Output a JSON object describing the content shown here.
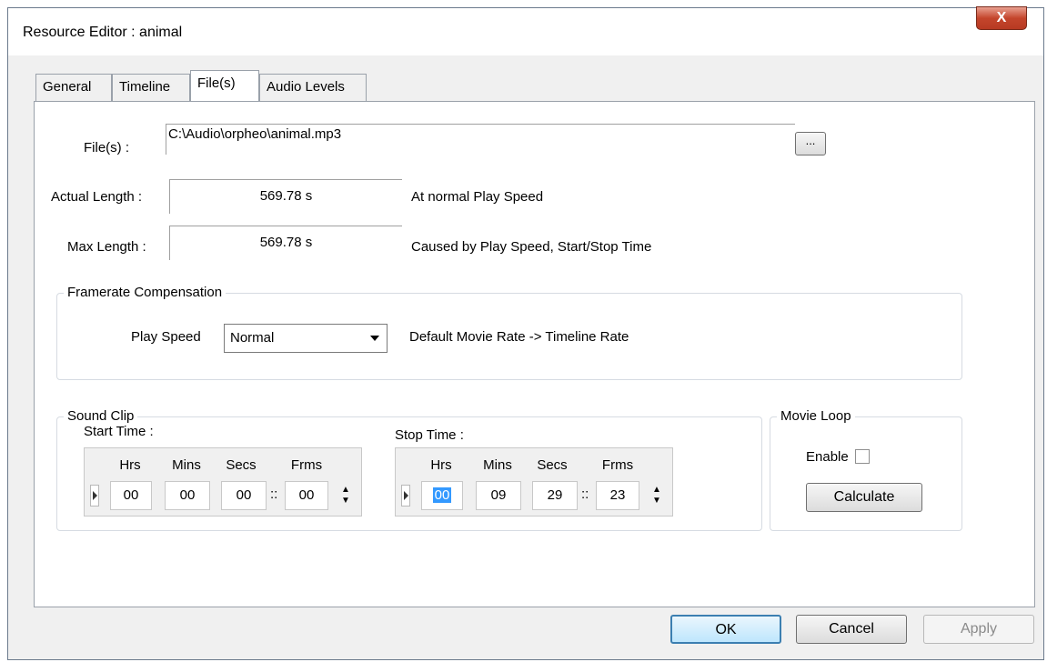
{
  "window": {
    "title": "Resource Editor  :  animal",
    "close_glyph": "X"
  },
  "tabs": [
    {
      "label": "General"
    },
    {
      "label": "Timeline"
    },
    {
      "label": "File(s)"
    },
    {
      "label": "Audio Levels"
    }
  ],
  "files": {
    "label": "File(s) :",
    "path": "C:\\Audio\\orpheo\\animal.mp3",
    "browse_label": "..."
  },
  "actual_length": {
    "label": "Actual Length :",
    "value": "569.78 s",
    "note": "At normal Play Speed"
  },
  "max_length": {
    "label": "Max Length :",
    "value": "569.78 s",
    "note": "Caused by Play Speed, Start/Stop Time"
  },
  "framerate": {
    "group_label": "Framerate Compensation",
    "play_speed_label": "Play Speed",
    "play_speed_value": "Normal",
    "note": "Default Movie Rate -> Timeline Rate"
  },
  "sound_clip": {
    "group_label": "Sound Clip",
    "headers": {
      "hrs": "Hrs",
      "mins": "Mins",
      "secs": "Secs",
      "frms": "Frms"
    },
    "frame_sep": "::",
    "start": {
      "label": "Start Time :",
      "hrs": "00",
      "mins": "00",
      "secs": "00",
      "frms": "00"
    },
    "stop": {
      "label": "Stop Time :",
      "hrs": "00",
      "mins": "09",
      "secs": "29",
      "frms": "23"
    }
  },
  "movie_loop": {
    "group_label": "Movie Loop",
    "enable_label": "Enable",
    "enabled": false,
    "calculate_label": "Calculate"
  },
  "footer": {
    "ok_label": "OK",
    "cancel_label": "Cancel",
    "apply_label": "Apply"
  },
  "colors": {
    "accent": "#3399ff",
    "close": "#c4452c",
    "disabled_text": "#8a8a8a"
  }
}
